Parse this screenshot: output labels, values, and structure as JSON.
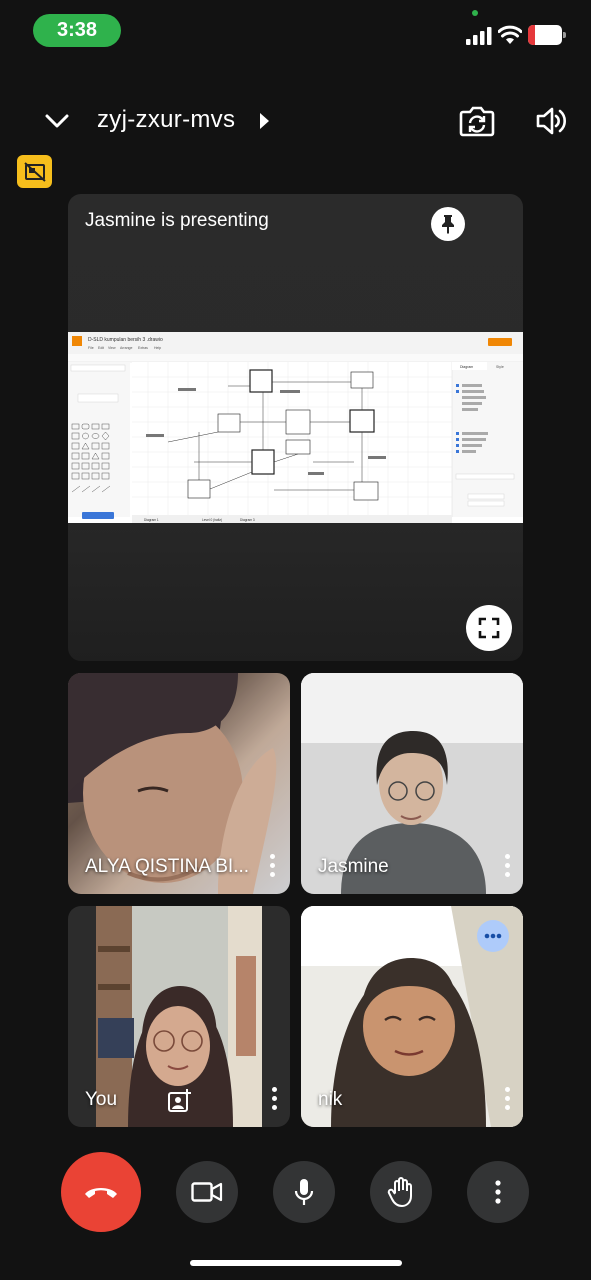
{
  "status_bar": {
    "time": "3:38",
    "battery_level": "20",
    "colors": {
      "time_pill": "#2fb24c",
      "battery_low": "#e5383b"
    },
    "icons": [
      "cellular-signal-icon",
      "wifi-icon",
      "battery-icon"
    ]
  },
  "header": {
    "meeting_code": "zyj-zxur-mvs",
    "icons": [
      "chevron-down-icon",
      "play-arrow-icon",
      "camera-switch-icon",
      "speaker-icon"
    ]
  },
  "pip_badge": {
    "icon": "no-video-frame-icon",
    "color": "#f6be1c"
  },
  "presentation": {
    "label": "Jasmine is presenting",
    "icons": [
      "pin-icon",
      "fullscreen-icon"
    ],
    "shared_screen": {
      "app_title": "D-SLD kumpulan bersih 3 .drawio",
      "menu": [
        "File",
        "Edit",
        "View",
        "Arrange",
        "Extras",
        "Help"
      ],
      "panel_tabs": [
        "Diagram",
        "Style"
      ],
      "page_tabs": [
        "Diagram 1",
        "Level 0 (hafiz)",
        "Diagram 3"
      ]
    }
  },
  "participants": [
    {
      "name": "ALYA QISTINA BI...",
      "has_more_menu": true
    },
    {
      "name": "Jasmine",
      "has_more_menu": true
    },
    {
      "name": "You",
      "has_more_menu": true,
      "icon": "add-person-frame-icon"
    },
    {
      "name": "nik",
      "has_more_menu": true,
      "badge_icon": "more-horiz-icon"
    }
  ],
  "controls": {
    "end_call": {
      "icon": "end-call-icon",
      "color": "#ea4335"
    },
    "camera": {
      "icon": "video-camera-icon"
    },
    "microphone": {
      "icon": "microphone-icon"
    },
    "raise_hand": {
      "icon": "raise-hand-icon"
    },
    "more": {
      "icon": "more-vert-icon"
    }
  }
}
